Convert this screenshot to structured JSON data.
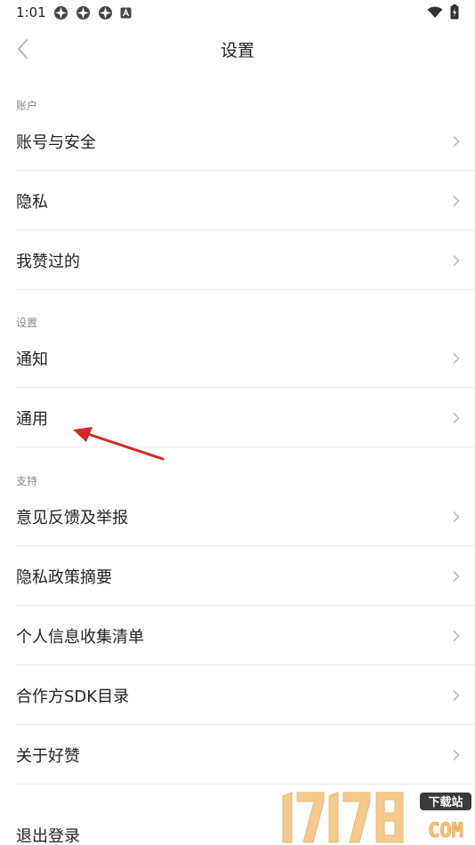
{
  "status_bar": {
    "time": "1:01",
    "left_icons": [
      "app-notification-icon",
      "app-notification-icon",
      "app-notification-icon",
      "a-badge-icon"
    ],
    "right_icons": [
      "wifi-icon",
      "battery-icon"
    ]
  },
  "header": {
    "title": "设置",
    "back_icon": "chevron-left-icon"
  },
  "sections": [
    {
      "label": "账户",
      "items": [
        {
          "label": "账号与安全"
        },
        {
          "label": "隐私"
        },
        {
          "label": "我赞过的"
        }
      ]
    },
    {
      "label": "设置",
      "items": [
        {
          "label": "通知"
        },
        {
          "label": "通用"
        }
      ]
    },
    {
      "label": "支持",
      "items": [
        {
          "label": "意见反馈及举报"
        },
        {
          "label": "隐私政策摘要"
        },
        {
          "label": "个人信息收集清单"
        },
        {
          "label": "合作方SDK目录"
        },
        {
          "label": "关于好赞"
        }
      ]
    }
  ],
  "logout": {
    "label": "退出登录"
  },
  "annotation": {
    "color": "#d9262a",
    "target": "通用"
  },
  "watermark": {
    "brand": "17178",
    "badge": "下载站",
    "domain_text": "COM"
  },
  "colors": {
    "divider": "#ececec",
    "section_label": "#888888",
    "chevron": "#bbbbbb",
    "text": "#222222"
  }
}
